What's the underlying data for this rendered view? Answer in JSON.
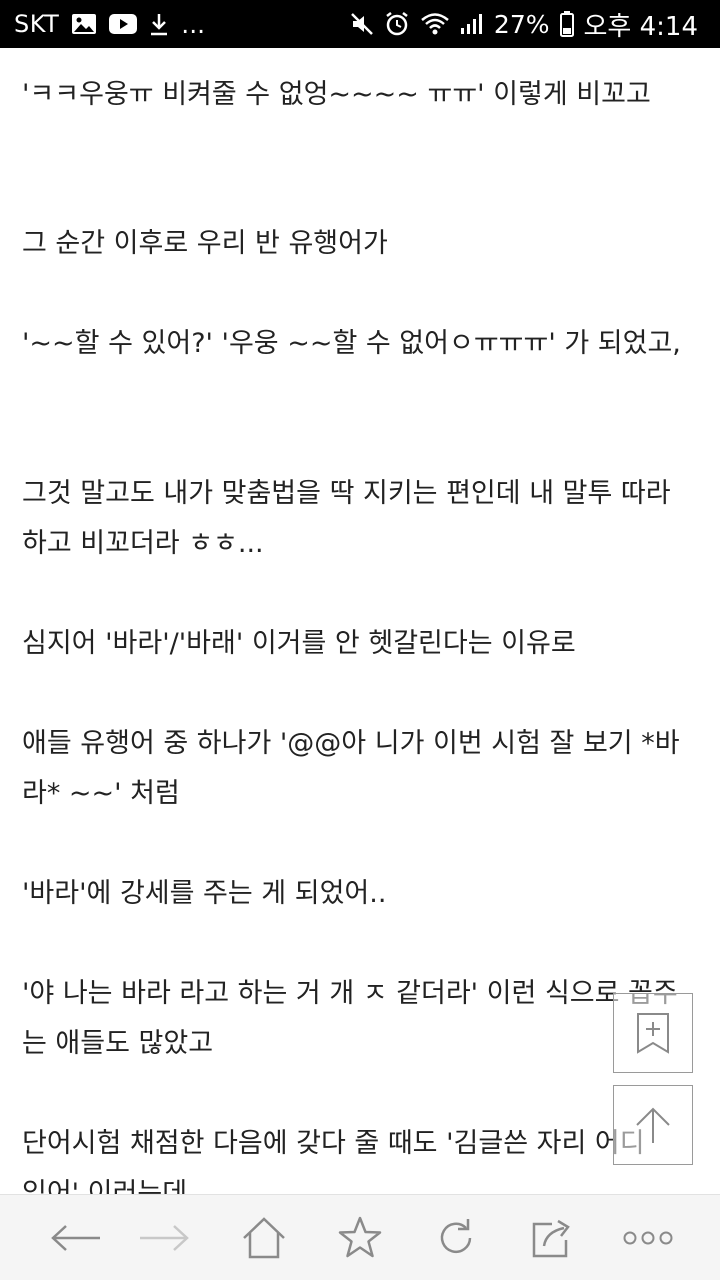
{
  "status_bar": {
    "carrier": "SKT",
    "more_indicator": "...",
    "battery_percent": "27%",
    "time": "오후 4:14",
    "left_icons": [
      "image-icon",
      "youtube-icon",
      "download-icon"
    ],
    "right_icons": [
      "mute-icon",
      "alarm-icon",
      "wifi-icon",
      "signal-icon",
      "battery-icon"
    ]
  },
  "article": {
    "paragraphs": [
      "'ㅋㅋ우웅ㅠ 비켜줄 수 없엉~~~~ ㅠㅠ' 이렇게 비꼬고",
      "그 순간 이후로 우리 반 유행어가",
      "'~~할 수 있어?' '우웅 ~~할 수 없어ㅇㅠㅠㅠ' 가 되었고,",
      "그것 말고도 내가 맞춤법을 딱 지키는 편인데 내 말투 따라",
      "하고 비꼬더라 ㅎㅎ...",
      "심지어 '바라'/'바래' 이거를 안 헷갈린다는 이유로",
      "애들 유행어 중 하나가 '@@아 니가 이번 시험 잘 보기 *바",
      "라* ~~' 처럼",
      "'바라'에 강세를 주는 게 되었어..",
      "'야 나는 바라 라고 하는 거 개 ㅈ 같더라' 이런 식으로 꼽주",
      "는 애들도 많았고",
      "단어시험 채점한 다음에 갖다 줄 때도 '김글쓴 자리 어디",
      "있어' 이러는데"
    ]
  },
  "floating_buttons": {
    "bookmark": "bookmark-add-icon",
    "scroll_top": "arrow-up-icon"
  },
  "bottom_nav": [
    "back-arrow-icon",
    "forward-arrow-icon",
    "home-icon",
    "star-icon",
    "refresh-icon",
    "share-icon",
    "more-icon"
  ],
  "colors": {
    "status_bar_bg": "#000000",
    "text": "#222222",
    "bottom_bar_bg": "#f5f5f5",
    "nav_icon": "#8a8a8a",
    "nav_icon_disabled": "#c8c8c8"
  }
}
